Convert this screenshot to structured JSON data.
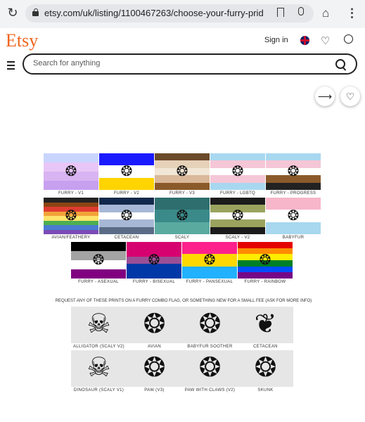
{
  "browser": {
    "url": "etsy.com/uk/listing/1100467263/choose-your-furry-prid",
    "icons": [
      "reload-icon",
      "lock-icon",
      "bookmark-icon",
      "mic-icon",
      "home-icon",
      "menu-dots-icon"
    ]
  },
  "site": {
    "logo": "Etsy",
    "sign_in": "Sign in",
    "search_placeholder": "Search for anything",
    "brand_color": "#f1641e"
  },
  "listing": {
    "row1": [
      {
        "caption": "Furry - V1",
        "icon": "paw-icon",
        "colors": [
          "#c9d5ff",
          "#e8c6f7",
          "#d8b4f2",
          "#c7a0f0"
        ]
      },
      {
        "caption": "Furry - V2",
        "icon": "paw-icon",
        "colors": [
          "#1a1aff",
          "#ffffff",
          "#ffd400"
        ]
      },
      {
        "caption": "Furry - V3",
        "icon": "paw-icon",
        "colors": [
          "#6b4a2a",
          "#e6d2b8",
          "#f2e6d6",
          "#d9b999",
          "#8b5a2b"
        ]
      },
      {
        "caption": "Furry - LGBTQ",
        "icon": "pride-paw-icon",
        "colors": [
          "#a8d8f0",
          "#f5c6d6",
          "#ffffff",
          "#f5c6d6",
          "#a8d8f0"
        ]
      },
      {
        "caption": "Furry - Progress",
        "icon": "pride-paw-icon",
        "colors": [
          "#a8d8f0",
          "#f5c6d6",
          "#ffffff",
          "#8b5a2b",
          "#222222"
        ]
      }
    ],
    "row2": [
      {
        "caption": "Avian/Feathery",
        "icon": "bird-foot-icon",
        "colors": [
          "#222",
          "#8b4513",
          "#e03c31",
          "#f2a33a",
          "#ffe46b",
          "#4caf50",
          "#4a7bd1",
          "#7b4bb5"
        ]
      },
      {
        "caption": "Cetacean",
        "icon": "whale-tail-icon",
        "colors": [
          "#13294b",
          "#a7b8d6",
          "#ffffff",
          "#a7b8d6",
          "#5a6b86"
        ]
      },
      {
        "caption": "Scaly",
        "icon": "lizard-foot-icon",
        "colors": [
          "#2e6e6e",
          "#3b8a8a",
          "#5aaaa0"
        ]
      },
      {
        "caption": "Scaly - V2",
        "icon": "dino-foot-icon",
        "colors": [
          "#1b1b1b",
          "#9aa35e",
          "#ffffff",
          "#9aa35e",
          "#1b1b1b"
        ]
      },
      {
        "caption": "Babyfur",
        "icon": "pacifier-paw-icon",
        "colors": [
          "#f7b6c9",
          "#ffffff",
          "#a7d8f0"
        ]
      }
    ],
    "row3": [
      {
        "caption": "Furry - Asexual",
        "icon": "paw-icon",
        "colors": [
          "#000000",
          "#a3a3a3",
          "#ffffff",
          "#800080"
        ]
      },
      {
        "caption": "Furry - Bisexual",
        "icon": "paw-icon",
        "colors": [
          "#d60270",
          "#d60270",
          "#9b4f96",
          "#0038a8",
          "#0038a8"
        ]
      },
      {
        "caption": "Furry - Pansexual",
        "icon": "paw-icon",
        "colors": [
          "#ff218c",
          "#ffd800",
          "#21b1ff"
        ]
      },
      {
        "caption": "Furry - Rainbow",
        "icon": "paw-icon",
        "colors": [
          "#e40303",
          "#ff8c00",
          "#ffed00",
          "#008026",
          "#004dff",
          "#750787"
        ]
      }
    ],
    "request_note": "Request any of these prints on a furry combo flag, or something new for a small fee (ask for more info)",
    "prints_row1": [
      {
        "caption": "Alligator (Scaly V2)",
        "icon": "alligator-foot-icon",
        "glyph": "☠"
      },
      {
        "caption": "Avian",
        "icon": "bird-foot-icon",
        "glyph": "❂"
      },
      {
        "caption": "Babyfur Soother",
        "icon": "pacifier-paw-icon",
        "glyph": "❂"
      },
      {
        "caption": "Cetacean",
        "icon": "whale-tail-icon",
        "glyph": "❦"
      }
    ],
    "prints_row2": [
      {
        "caption": "Dinosaur (Scaly V1)",
        "icon": "dino-foot-icon",
        "glyph": "☠"
      },
      {
        "caption": "Paw (V3)",
        "icon": "paw-icon",
        "glyph": "❂"
      },
      {
        "caption": "Paw with Claws (V2)",
        "icon": "paw-claws-icon",
        "glyph": "❂"
      },
      {
        "caption": "Skunk",
        "icon": "skunk-paw-icon",
        "glyph": "❂"
      }
    ]
  }
}
